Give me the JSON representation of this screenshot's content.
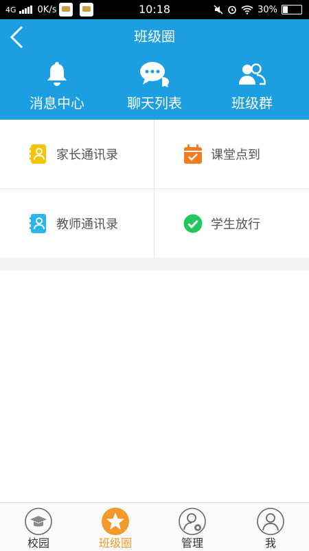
{
  "status_bar": {
    "network": "4G",
    "speed": "0K/s",
    "time": "10:18",
    "battery": "30%",
    "battery_level": 0.3
  },
  "header": {
    "title": "班级圈",
    "quick_actions": [
      {
        "label": "消息中心",
        "icon": "bell-icon"
      },
      {
        "label": "聊天列表",
        "icon": "chat-bubbles-icon"
      },
      {
        "label": "班级群",
        "icon": "group-icon"
      }
    ]
  },
  "menu": [
    {
      "label": "家长通讯录",
      "icon": "parent-contacts-icon",
      "color": "#f5c400"
    },
    {
      "label": "课堂点到",
      "icon": "calendar-check-icon",
      "color": "#f57c1e"
    },
    {
      "label": "教师通讯录",
      "icon": "teacher-contacts-icon",
      "color": "#29b6f0"
    },
    {
      "label": "学生放行",
      "icon": "check-circle-icon",
      "color": "#22c55e"
    }
  ],
  "tabs": [
    {
      "label": "校园",
      "icon": "graduation-cap-icon",
      "active": false
    },
    {
      "label": "班级圈",
      "icon": "star-icon",
      "active": true
    },
    {
      "label": "管理",
      "icon": "admin-user-icon",
      "active": false
    },
    {
      "label": "我",
      "icon": "user-icon",
      "active": false
    }
  ],
  "colors": {
    "header": "#1c9fe0",
    "active_tab": "#f09a2c"
  }
}
